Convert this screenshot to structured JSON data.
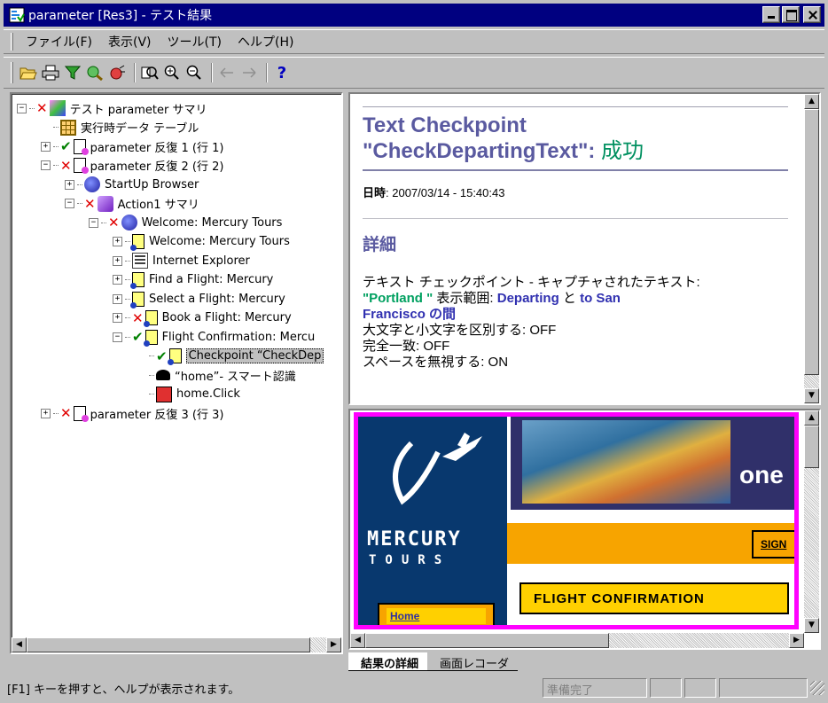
{
  "window": {
    "title": "parameter [Res3] - テスト結果"
  },
  "menu": {
    "items": [
      "ファイル(F)",
      "表示(V)",
      "ツール(T)",
      "ヘルプ(H)"
    ]
  },
  "toolbar": {
    "icons": [
      "open-icon",
      "print-icon",
      "filter-icon",
      "find-icon",
      "bug-icon",
      "zoom-fit-icon",
      "zoom-in-icon",
      "zoom-out-icon",
      "arrow-left-icon",
      "arrow-right-icon",
      "help-icon"
    ],
    "help_glyph": "?"
  },
  "tree": {
    "nodes": [
      {
        "text": "テスト parameter サマリ",
        "status": "fail",
        "icon": "summary-icon",
        "expander": "−"
      },
      {
        "text": "実行時データ テーブル",
        "status": "",
        "icon": "datatable-icon",
        "expander": ""
      },
      {
        "text": "parameter 反復 1 (行 1)",
        "status": "pass",
        "icon": "iteration-icon",
        "expander": "+"
      },
      {
        "text": "parameter 反復 2 (行 2)",
        "status": "fail",
        "icon": "iteration-icon",
        "expander": "−"
      },
      {
        "text": "StartUp Browser",
        "status": "",
        "icon": "globe-icon",
        "expander": "+"
      },
      {
        "text": "Action1 サマリ",
        "status": "fail",
        "icon": "action-icon",
        "expander": "−"
      },
      {
        "text": "Welcome: Mercury Tours",
        "status": "fail",
        "icon": "globe-icon",
        "expander": "−"
      },
      {
        "text": "Welcome: Mercury Tours",
        "status": "",
        "icon": "page-icon",
        "expander": "+"
      },
      {
        "text": "Internet Explorer",
        "status": "",
        "icon": "window-icon",
        "expander": "+"
      },
      {
        "text": "Find a Flight: Mercury",
        "status": "",
        "icon": "page-icon",
        "expander": "+"
      },
      {
        "text": "Select a Flight: Mercury",
        "status": "",
        "icon": "page-icon",
        "expander": "+"
      },
      {
        "text": "Book a Flight: Mercury",
        "status": "fail",
        "icon": "page-icon",
        "expander": "+"
      },
      {
        "text": "Flight Confirmation: Mercu",
        "status": "pass",
        "icon": "page-icon",
        "expander": "−"
      },
      {
        "text": "Checkpoint “CheckDep",
        "status": "pass",
        "icon": "page-icon",
        "expander": "",
        "selected": true
      },
      {
        "text": "“home”- スマート認識",
        "status": "",
        "icon": "smart-icon",
        "expander": ""
      },
      {
        "text": "home.Click",
        "status": "",
        "icon": "click-icon",
        "expander": ""
      },
      {
        "text": "parameter 反復 3 (行 3)",
        "status": "fail",
        "icon": "iteration-icon",
        "expander": "+"
      }
    ]
  },
  "result": {
    "title_line1": "Text Checkpoint",
    "title_line2": "\"CheckDepartingText\": ",
    "status_text": "成功",
    "date_label": "日時",
    "date_value": ": 2007/03/14 - 15:40:43",
    "details_heading": "詳細",
    "captured_label": "テキスト チェックポイント - キャプチャされたテキスト:",
    "captured_text": "\"Portland \"",
    "range_label": " 表示範囲: ",
    "range_from": "Departing",
    "range_and": " と ",
    "range_to": "to San",
    "range_to2": "Francisco の間",
    "case_label": "大文字と小文字を区別する: OFF",
    "exact_label": "完全一致: OFF",
    "space_label": "スペースを無視する: ON"
  },
  "snapshot": {
    "one_text": "one",
    "sign_text": "SIGN",
    "flight_text": "FLIGHT CONFIRMATION",
    "logo_line1": "MERCURY",
    "logo_line2": "TOURS",
    "home_link": "Home"
  },
  "tabs": {
    "items": [
      "結果の詳細",
      "画面レコーダ"
    ],
    "active_index": 0
  },
  "status": {
    "message": "[F1] キーを押すと、ヘルプが表示されます。",
    "state": "準備完了"
  }
}
